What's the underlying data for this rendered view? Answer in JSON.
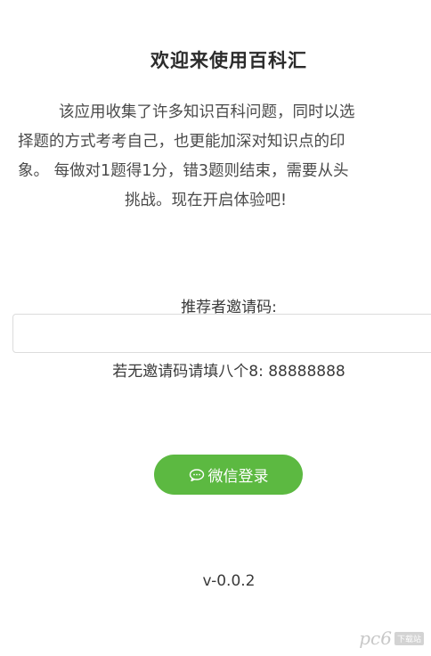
{
  "app": {
    "title": "欢迎来使用百科汇",
    "intro_lines": [
      "该应用收集了许多知识百科问题，同时以选",
      "择题的方式考考自己，也更能加深对知识点的印",
      "象。 每做对1题得1分，错3题则结束，需要从头",
      "挑战。现在开启体验吧!"
    ]
  },
  "invite": {
    "label": "推荐者邀请码:",
    "value": "",
    "placeholder": "",
    "hint": "若无邀请码请填八个8: 88888888"
  },
  "login": {
    "button_label": "微信登录",
    "icon": "chat-bubble-icon",
    "color": "#5cb941"
  },
  "footer": {
    "version": "v-0.0.2"
  },
  "watermark": {
    "logo": "pc6",
    "site_label": "下载站"
  }
}
